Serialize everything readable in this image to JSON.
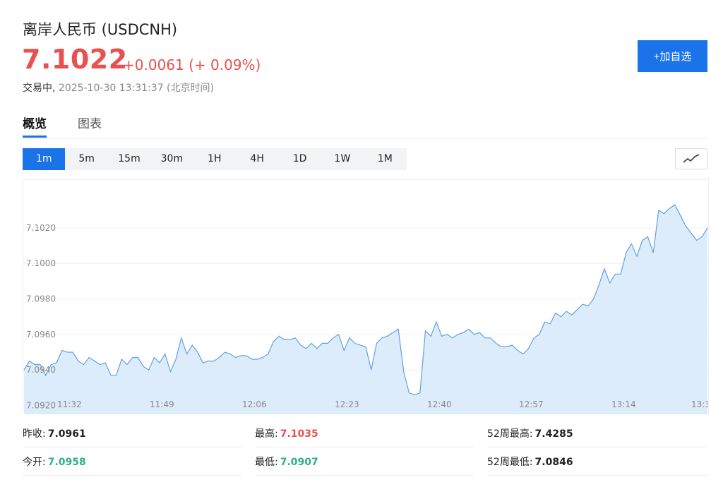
{
  "header": {
    "title": "离岸人民币 (USDCNH)",
    "price": "7.1022",
    "change": "+0.0061 (+ 0.09%)",
    "status_label": "交易中,",
    "timestamp": "2025-10-30 13:31:37 (北京时间)",
    "add_button": "+加自选"
  },
  "tabs": [
    {
      "label": "概览",
      "active": true
    },
    {
      "label": "图表",
      "active": false
    }
  ],
  "periods": [
    {
      "label": "1m",
      "active": true
    },
    {
      "label": "5m",
      "active": false
    },
    {
      "label": "15m",
      "active": false
    },
    {
      "label": "30m",
      "active": false
    },
    {
      "label": "1H",
      "active": false
    },
    {
      "label": "4H",
      "active": false
    },
    {
      "label": "1D",
      "active": false
    },
    {
      "label": "1W",
      "active": false
    },
    {
      "label": "1M",
      "active": false
    }
  ],
  "chart_type_icon": "line-chart-icon",
  "colors": {
    "up": "#e8514f",
    "down": "#2eb084",
    "accent": "#1a73e8",
    "line": "#5ea1e6",
    "area": "#dcecfb"
  },
  "chart_data": {
    "type": "area",
    "grid": true,
    "ylim": [
      7.0915,
      7.1047
    ],
    "y_ticks": [
      "7.1020",
      "7.1000",
      "7.0980",
      "7.0960",
      "7.0940",
      "7.0920"
    ],
    "x_tick_labels": [
      "11:32",
      "11:49",
      "12:06",
      "12:23",
      "12:40",
      "12:57",
      "13:14",
      "13:3"
    ],
    "values": [
      7.094,
      7.0945,
      7.0943,
      7.0943,
      7.0937,
      7.0943,
      7.0944,
      7.0951,
      7.095,
      7.095,
      7.0945,
      7.0943,
      7.0947,
      7.0945,
      7.0943,
      7.0944,
      7.0937,
      7.0937,
      7.0946,
      7.0943,
      7.0947,
      7.0947,
      7.0942,
      7.094,
      7.0947,
      7.0944,
      7.0949,
      7.0939,
      7.0946,
      7.0958,
      7.0949,
      7.0954,
      7.095,
      7.0944,
      7.0945,
      7.0945,
      7.0947,
      7.095,
      7.0949,
      7.0947,
      7.0948,
      7.0948,
      7.0946,
      7.0946,
      7.0947,
      7.0949,
      7.0956,
      7.0959,
      7.0957,
      7.0957,
      7.0958,
      7.0954,
      7.0952,
      7.0955,
      7.0952,
      7.0955,
      7.0955,
      7.0958,
      7.096,
      7.0951,
      7.0958,
      7.0955,
      7.0954,
      7.0953,
      7.094,
      7.0955,
      7.0958,
      7.0959,
      7.0961,
      7.0963,
      7.0939,
      7.0927,
      7.0926,
      7.0927,
      7.0962,
      7.0959,
      7.0967,
      7.0959,
      7.096,
      7.0958,
      7.096,
      7.0961,
      7.0963,
      7.096,
      7.0961,
      7.0958,
      7.0958,
      7.0955,
      7.0953,
      7.0953,
      7.0954,
      7.0951,
      7.0949,
      7.0952,
      7.0958,
      7.096,
      7.0967,
      7.0966,
      7.0972,
      7.097,
      7.0973,
      7.0971,
      7.0974,
      7.0977,
      7.0976,
      7.098,
      7.0988,
      7.0997,
      7.0989,
      7.0994,
      7.0994,
      7.1006,
      7.1011,
      7.1004,
      7.1013,
      7.1015,
      7.1006,
      7.103,
      7.1028,
      7.1031,
      7.1033,
      7.1027,
      7.1021,
      7.1017,
      7.1013,
      7.1015,
      7.102
    ]
  },
  "stats": {
    "prev_close_label": "昨收:",
    "prev_close": "7.0961",
    "high_label": "最高:",
    "high": "7.1035",
    "week52_high_label": "52周最高:",
    "week52_high": "7.4285",
    "open_label": "今开:",
    "open": "7.0958",
    "low_label": "最低:",
    "low": "7.0907",
    "week52_low_label": "52周最低:",
    "week52_low": "7.0846"
  }
}
